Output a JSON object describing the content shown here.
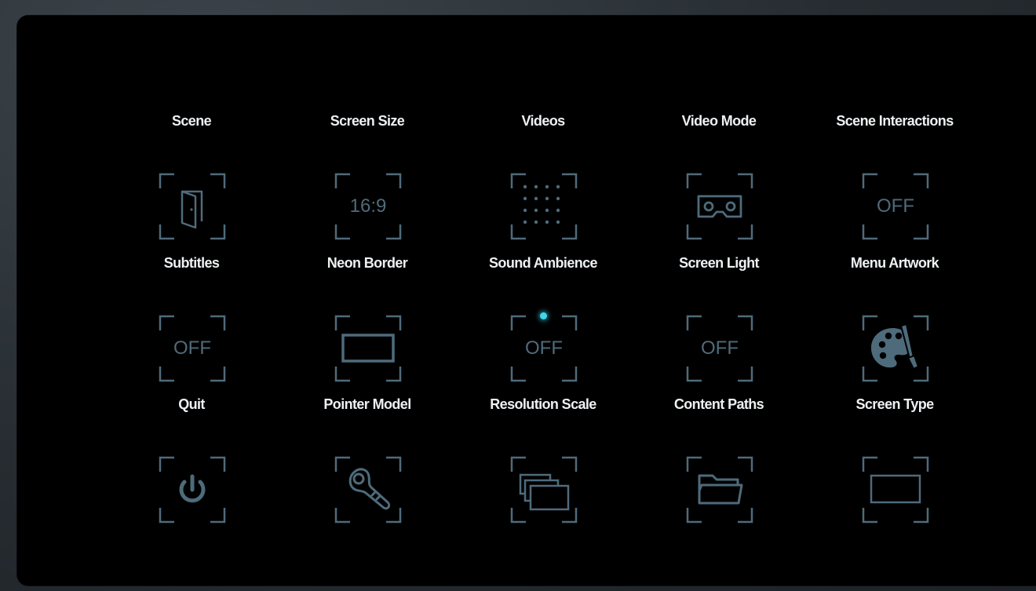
{
  "accent_color": "#41d6ea",
  "icon_color": "#4e6b7b",
  "label_color": "#eef1f3",
  "menu": {
    "items": [
      {
        "label": "Scene",
        "icon": "door-icon"
      },
      {
        "label": "Screen Size",
        "icon_text": "16:9"
      },
      {
        "label": "Videos",
        "icon": "grid-dots-icon"
      },
      {
        "label": "Video Mode",
        "icon": "vr-headset-icon"
      },
      {
        "label": "Scene Interactions",
        "icon_text": "OFF"
      },
      {
        "label": "Subtitles",
        "icon_text": "OFF"
      },
      {
        "label": "Neon Border",
        "icon": "rectangle-outline-icon"
      },
      {
        "label": "Sound Ambience",
        "icon_text": "OFF",
        "indicator": "active-dot"
      },
      {
        "label": "Screen Light",
        "icon_text": "OFF"
      },
      {
        "label": "Menu Artwork",
        "icon": "palette-icon"
      },
      {
        "label": "Quit",
        "icon": "power-icon"
      },
      {
        "label": "Pointer Model",
        "icon": "controller-icon"
      },
      {
        "label": "Resolution Scale",
        "icon": "stacked-screens-icon"
      },
      {
        "label": "Content Paths",
        "icon": "folder-icon"
      },
      {
        "label": "Screen Type",
        "icon": "flat-screen-icon"
      }
    ]
  }
}
